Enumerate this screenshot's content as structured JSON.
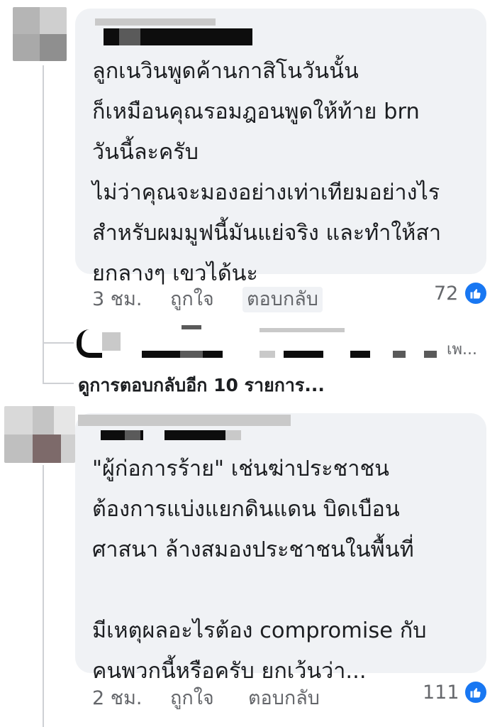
{
  "comments": [
    {
      "text": "ลูกเนวินพูดค้านกาสิโนวันนั้น\nก็เหมือนคุณรอมฎอนพูดให้ท้าย brn\nวันนี้ละครับ\nไม่ว่าคุณจะมองอย่างเท่าเทียมอย่างไร\nสำหรับผมมูฟนี้มันแย่จริง และทำให้สา\nยกลางๆ เขวได้นะ",
      "time": "3 ชม.",
      "like_label": "ถูกใจ",
      "reply_label": "ตอบกลับ",
      "reaction_count": "72",
      "reaction_icon": "like-icon",
      "reaction_color": "#1877f2"
    },
    {
      "text": "\"ผู้ก่อการร้าย\" เช่นฆ่าประชาชน\nต้องการแบ่งแยกดินแดน บิดเบือน\nศาสนา ล้างสมองประชาชนในพื้นที่\n\nมีเหตุผลอะไรต้อง compromise กับ\nคนพวกนี้หรือครับ ยกเว้นว่า...",
      "time": "2 ชม.",
      "like_label": "ถูกใจ",
      "reply_label": "ตอบกลับ",
      "reaction_count": "111",
      "reaction_icon": "like-icon",
      "reaction_color": "#1877f2"
    }
  ],
  "reply_preview": {
    "trailing_text": "เพ..."
  },
  "more_replies_label": "ดูการตอบกลับอีก 10 รายการ..."
}
